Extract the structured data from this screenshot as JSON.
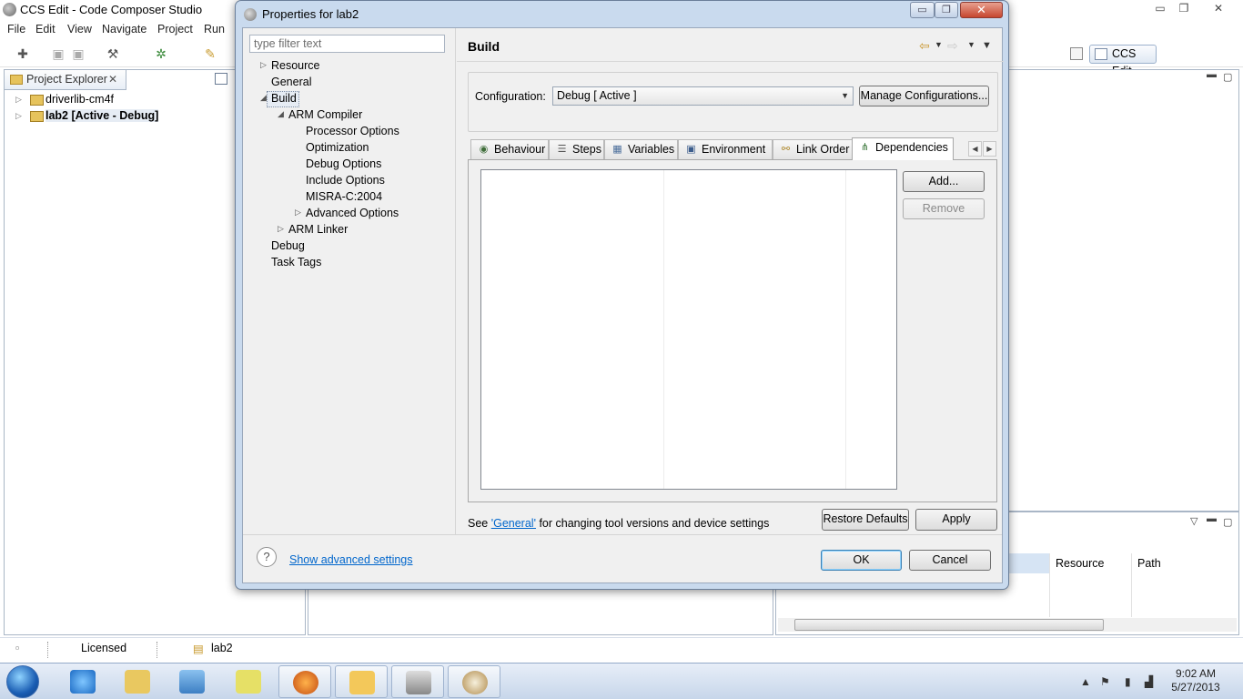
{
  "app": {
    "title": "CCS Edit - Code Composer Studio",
    "menu": [
      "File",
      "Edit",
      "View",
      "Navigate",
      "Project",
      "Run"
    ],
    "perspective_label": "CCS Edit",
    "window_controls": {
      "minimize": "▭",
      "maximize": "❐",
      "close": "✕"
    }
  },
  "project_explorer": {
    "tab_label": "Project Explorer",
    "items": [
      {
        "label": "driverlib-cm4f"
      },
      {
        "label": "lab2  [Active - Debug]"
      }
    ]
  },
  "problems_view": {
    "columns": [
      "Resource",
      "Path"
    ]
  },
  "statusbar": {
    "licensed": "Licensed",
    "project": "lab2"
  },
  "taskbar": {
    "time": "9:02 AM",
    "date": "5/27/2013"
  },
  "dialog": {
    "title": "Properties for lab2",
    "filter_placeholder": "type filter text",
    "tree": [
      {
        "label": "Resource",
        "expander": "▷"
      },
      {
        "label": "General"
      },
      {
        "label": "Build",
        "expander": "◢",
        "selected": true
      },
      {
        "label": "ARM Compiler",
        "expander": "◢"
      },
      {
        "label": "Processor Options"
      },
      {
        "label": "Optimization"
      },
      {
        "label": "Debug Options"
      },
      {
        "label": "Include Options"
      },
      {
        "label": "MISRA-C:2004"
      },
      {
        "label": "Advanced Options",
        "expander": "▷"
      },
      {
        "label": "ARM Linker",
        "expander": "▷"
      },
      {
        "label": "Debug"
      },
      {
        "label": "Task Tags"
      }
    ],
    "page_title": "Build",
    "configuration_label": "Configuration:",
    "configuration_value": "Debug  [ Active ]",
    "manage_configurations": "Manage Configurations...",
    "tabs": [
      {
        "label": "Behaviour",
        "icon": "behaviour-icon"
      },
      {
        "label": "Steps",
        "icon": "steps-icon"
      },
      {
        "label": "Variables",
        "icon": "variables-icon"
      },
      {
        "label": "Environment",
        "icon": "environment-icon"
      },
      {
        "label": "Link Order",
        "icon": "link-order-icon"
      },
      {
        "label": "Dependencies",
        "icon": "dependencies-icon",
        "selected": true
      }
    ],
    "add_button": "Add...",
    "remove_button": "Remove",
    "see_prefix": "See ",
    "general_link": "'General'",
    "see_suffix": " for changing tool versions and device settings",
    "restore_defaults": "Restore Defaults",
    "apply": "Apply",
    "show_advanced": "Show advanced settings",
    "ok": "OK",
    "cancel": "Cancel"
  },
  "colors": {
    "dialog_frame": "#c9daee",
    "link": "#0066cc",
    "close_button": "#c6462f"
  }
}
